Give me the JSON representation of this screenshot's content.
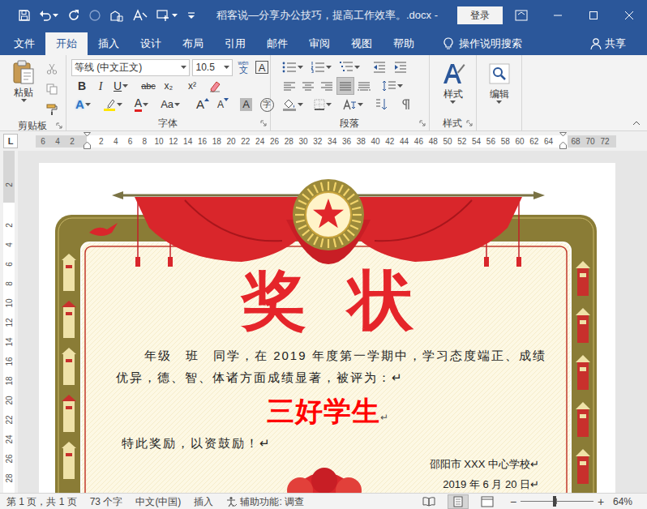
{
  "window": {
    "title": "稻客说—分享办公技巧，提高工作效率。.docx  -",
    "login": "登录"
  },
  "tabs": [
    {
      "label": "文件",
      "selected": false
    },
    {
      "label": "开始",
      "selected": true
    },
    {
      "label": "插入",
      "selected": false
    },
    {
      "label": "设计",
      "selected": false
    },
    {
      "label": "布局",
      "selected": false
    },
    {
      "label": "引用",
      "selected": false
    },
    {
      "label": "邮件",
      "selected": false
    },
    {
      "label": "审阅",
      "selected": false
    },
    {
      "label": "视图",
      "selected": false
    },
    {
      "label": "帮助",
      "selected": false
    }
  ],
  "tell_me": "操作说明搜索",
  "share": "共享",
  "ribbon": {
    "clipboard": {
      "paste": "粘贴",
      "label": "剪贴板"
    },
    "font": {
      "label": "字体",
      "name": "等线 (中文正文)",
      "size": "10.5",
      "phonetic": {
        "pinyin": "wén",
        "char": "文"
      },
      "char_border": "A",
      "row2": [
        {
          "label": "B",
          "kind": "bold"
        },
        {
          "label": "I",
          "kind": "italic"
        },
        {
          "label": "U",
          "kind": "underline"
        },
        {
          "label": "abc",
          "kind": "strike"
        },
        {
          "label": "x₂",
          "kind": "sub"
        },
        {
          "label": "x²",
          "kind": "sup"
        }
      ],
      "row3": [
        {
          "label": "A",
          "kind": "effects"
        },
        {
          "kind": "highlight"
        },
        {
          "label": "A",
          "kind": "font-color"
        },
        {
          "label": "Aa",
          "kind": "case"
        },
        {
          "label": "A",
          "kind": "grow"
        },
        {
          "label": "A",
          "kind": "shrink"
        },
        {
          "label": "A",
          "kind": "shading"
        },
        {
          "label": "字",
          "kind": "enclose"
        }
      ]
    },
    "paragraph": {
      "label": "段落",
      "alignments": [
        {
          "kind": "left",
          "selected": false
        },
        {
          "kind": "center",
          "selected": false
        },
        {
          "kind": "right",
          "selected": false
        },
        {
          "kind": "justify",
          "selected": true
        },
        {
          "kind": "distributed",
          "selected": false
        }
      ]
    },
    "styles": {
      "button": "样式",
      "label": "样式"
    },
    "editing": {
      "button": "编辑"
    }
  },
  "ruler": {
    "tab_selector": "L",
    "left": [
      "6",
      "4",
      "2"
    ],
    "main": [
      "2",
      "4",
      "6",
      "8",
      "10",
      "12",
      "14",
      "16",
      "18",
      "20",
      "22",
      "24",
      "26",
      "28",
      "30",
      "32",
      "34",
      "36",
      "38",
      "40",
      "42",
      "44",
      "46",
      "48",
      "50",
      "52",
      "54",
      "56",
      "58",
      "60",
      "62",
      "64"
    ],
    "right": [
      "68",
      "70",
      "72"
    ],
    "vertical_top": [
      "2"
    ],
    "vertical": [
      "2",
      "4",
      "6",
      "8",
      "10",
      "12",
      "14",
      "16",
      "18",
      "20",
      "22",
      "24",
      "26",
      "28"
    ]
  },
  "document": {
    "title": "奖 状",
    "body_lines": [
      "年级　班　同学，在 2019 年度第一学期中，学习态度端正、成绩",
      "优异，德、智、体诸方面成绩显著，被评为：↵"
    ],
    "award": "三好学生",
    "award_mark": "↵",
    "closing": "特此奖励，以资鼓励！↵",
    "school": "邵阳市 XXX 中心学校↵",
    "date": "2019 年 6 月 20 日↵"
  },
  "status_bar": {
    "page": "第 1 页，共 1 页",
    "words": "73 个字",
    "language": "中文(中国)",
    "mode": "插入",
    "accessibility": "辅助功能: 调查",
    "views": [
      {
        "kind": "read",
        "selected": false
      },
      {
        "kind": "print",
        "selected": true
      },
      {
        "kind": "web",
        "selected": false
      }
    ],
    "zoom": {
      "minus": "−",
      "plus": "+",
      "level": 0.47,
      "reading": "64%"
    }
  }
}
